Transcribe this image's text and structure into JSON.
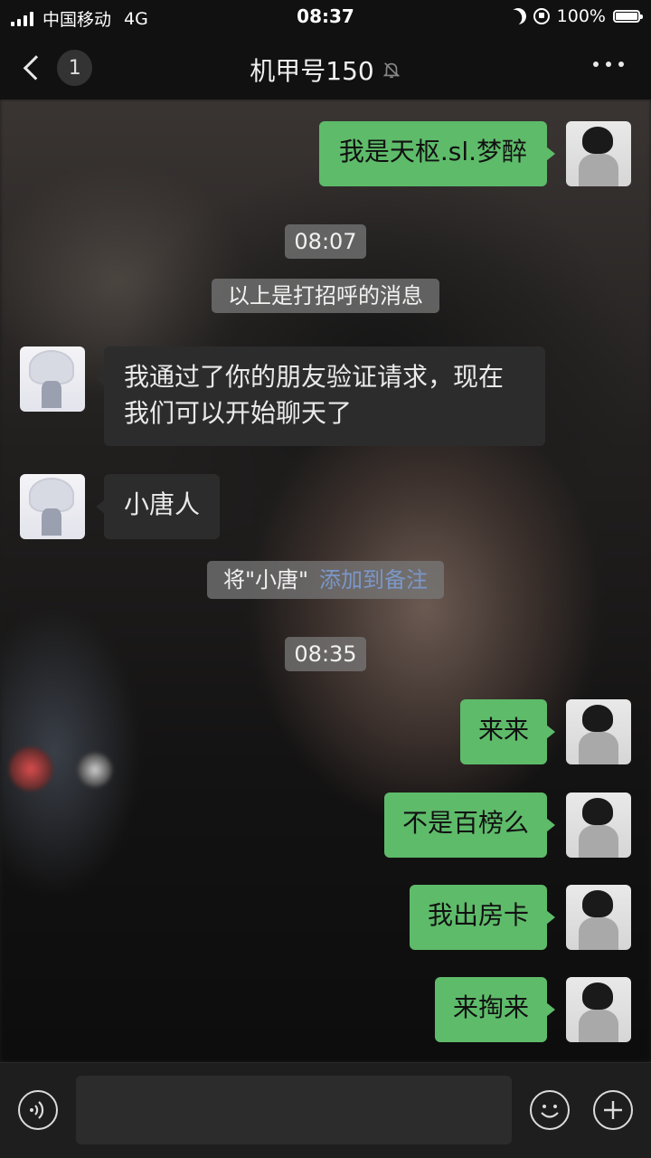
{
  "status_bar": {
    "carrier": "中国移动",
    "network": "4G",
    "time": "08:37",
    "battery": "100%"
  },
  "nav": {
    "unread_count": "1",
    "title": "机甲号150",
    "muted": true
  },
  "messages": [
    {
      "sender": "me",
      "text": "我是天枢.sl.梦醉"
    },
    {
      "type": "timestamp",
      "text": "08:07"
    },
    {
      "type": "system",
      "text": "以上是打招呼的消息"
    },
    {
      "sender": "other",
      "text": "我通过了你的朋友验证请求，现在我们可以开始聊天了"
    },
    {
      "sender": "other",
      "text": "小唐人"
    },
    {
      "type": "system",
      "text": "将\"小唐\"",
      "link": "添加到备注"
    },
    {
      "type": "timestamp",
      "text": "08:35"
    },
    {
      "sender": "me",
      "text": "来来"
    },
    {
      "sender": "me",
      "text": "不是百榜么"
    },
    {
      "sender": "me",
      "text": "我出房卡"
    },
    {
      "sender": "me",
      "text": "来掏来"
    }
  ],
  "input": {
    "value": "",
    "placeholder": ""
  },
  "icons": [
    "signal-icon",
    "moon-icon",
    "rotation-lock-icon",
    "battery-icon",
    "back-chevron-icon",
    "mute-bell-icon",
    "more-icon",
    "voice-icon",
    "emoji-icon",
    "plus-icon"
  ],
  "colors": {
    "my_bubble": "#5ebb6a",
    "other_bubble": "#2c2c2c",
    "link": "#7b97c9"
  }
}
